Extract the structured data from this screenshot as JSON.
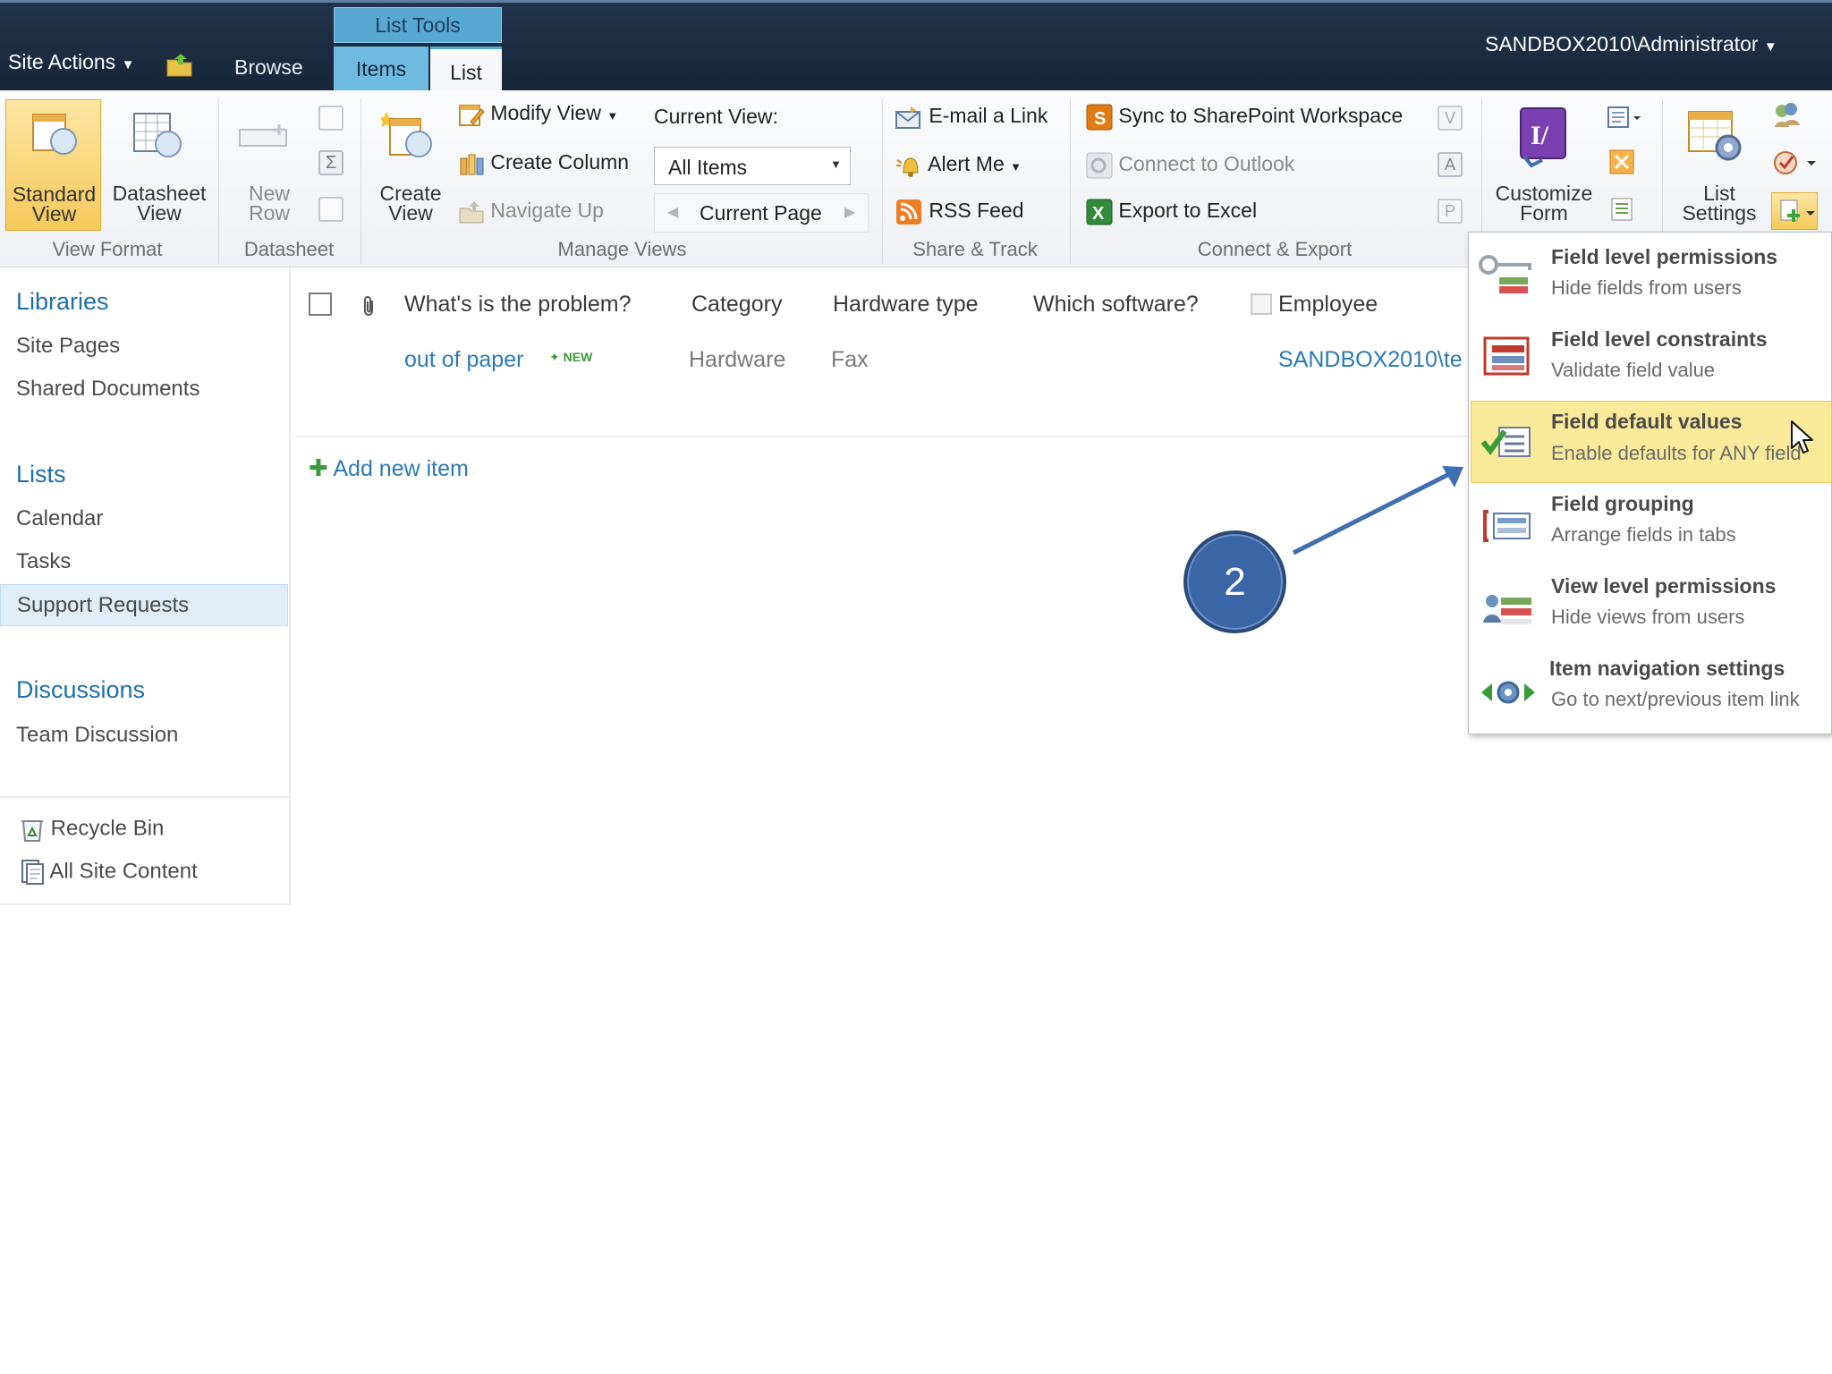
{
  "topbar": {
    "site_actions": "Site Actions",
    "browse_tab": "Browse",
    "list_tools": "List Tools",
    "items_tab": "Items",
    "list_tab": "List",
    "user": "SANDBOX2010\\Administrator"
  },
  "ribbon": {
    "view_format": {
      "label": "View Format",
      "standard_view": [
        "Standard",
        "View"
      ],
      "datasheet_view": [
        "Datasheet",
        "View"
      ]
    },
    "datasheet": {
      "label": "Datasheet",
      "new_row": [
        "New",
        "Row"
      ]
    },
    "manage_views": {
      "label": "Manage Views",
      "create_view": [
        "Create",
        "View"
      ],
      "modify_view": "Modify View",
      "create_column": "Create Column",
      "navigate_up": "Navigate Up",
      "current_view_label": "Current View:",
      "current_view_value": "All Items",
      "current_page": "Current Page"
    },
    "share_track": {
      "label": "Share & Track",
      "email_link": "E-mail a Link",
      "alert_me": "Alert Me",
      "rss_feed": "RSS Feed"
    },
    "connect_export": {
      "label": "Connect & Export",
      "sync": "Sync to SharePoint Workspace",
      "outlook": "Connect to Outlook",
      "excel": "Export to Excel"
    },
    "customize_form": [
      "Customize",
      "Form"
    ],
    "list_settings": [
      "List",
      "Settings"
    ]
  },
  "nav": {
    "libraries": "Libraries",
    "library_items": [
      "Site Pages",
      "Shared Documents"
    ],
    "lists": "Lists",
    "list_items": [
      "Calendar",
      "Tasks",
      "Support Requests"
    ],
    "discussions": "Discussions",
    "discussion_items": [
      "Team Discussion"
    ],
    "recycle_bin": "Recycle Bin",
    "all_site_content": "All Site Content"
  },
  "list": {
    "columns": [
      "What's is the problem?",
      "Category",
      "Hardware type",
      "Which software?",
      "Employee"
    ],
    "row": {
      "title": "out of paper",
      "new_badge": "NEW",
      "category": "Hardware",
      "hardware_type": "Fax",
      "employee": "SANDBOX2010\\te"
    },
    "add_new_item": "Add new item"
  },
  "menu": {
    "items": [
      {
        "title": "Field level permissions",
        "desc": "Hide fields from users"
      },
      {
        "title": "Field level constraints",
        "desc": "Validate field value"
      },
      {
        "title": "Field default values",
        "desc": "Enable defaults for ANY field"
      },
      {
        "title": "Field grouping",
        "desc": "Arrange fields in tabs"
      },
      {
        "title": "View level permissions",
        "desc": "Hide views from users"
      },
      {
        "title": "Item navigation settings",
        "desc": "Go to next/previous item link"
      }
    ]
  },
  "annotation": {
    "step": "2"
  },
  "colors": {
    "topbar": "#1b2d43",
    "accent": "#58a8d4",
    "highlight": "#fbea9a",
    "link": "#2a7ab8",
    "callout": "#3a66a7"
  }
}
